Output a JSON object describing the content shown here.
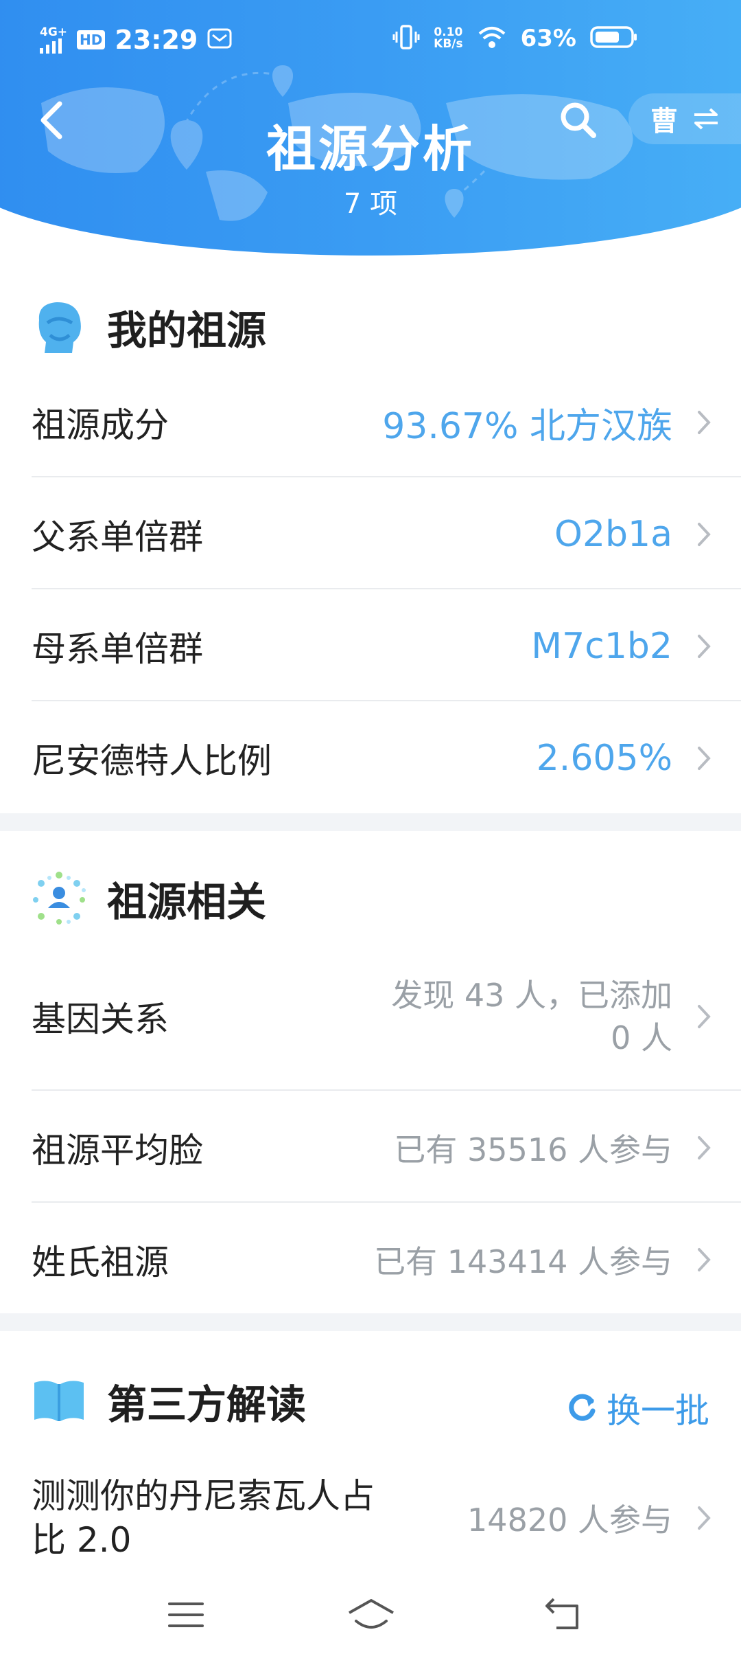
{
  "colors": {
    "header_gradient_start": "#2f8df0",
    "header_gradient_end": "#48b0f6",
    "accent_blue": "#4ea6ec",
    "muted_gray": "#9aa0a6",
    "divider": "#f2f4f7"
  },
  "status_bar": {
    "network": "4G+",
    "hd": "HD",
    "time": "23:29",
    "net_speed_value": "0.10",
    "net_speed_unit": "KB/s",
    "battery": "63%",
    "icons": [
      "signal-icon",
      "mail-icon",
      "vibrate-icon",
      "wifi-icon",
      "battery-icon"
    ]
  },
  "header": {
    "title": "祖源分析",
    "subtitle": "7 项",
    "surname": "曹",
    "icons": [
      "back-icon",
      "search-icon",
      "swap-icon"
    ]
  },
  "my_ancestry": {
    "title": "我的祖源",
    "rows": [
      {
        "label": "祖源成分",
        "value": "93.67% 北方汉族"
      },
      {
        "label": "父系单倍群",
        "value": "O2b1a"
      },
      {
        "label": "母系单倍群",
        "value": "M7c1b2"
      },
      {
        "label": "尼安德特人比例",
        "value": "2.605%"
      }
    ]
  },
  "related": {
    "title": "祖源相关",
    "rows": [
      {
        "label": "基因关系",
        "value_line1": "发现 43 人，已添加",
        "value_line2": "0 人"
      },
      {
        "label": "祖源平均脸",
        "value": "已有 35516 人参与"
      },
      {
        "label": "姓氏祖源",
        "value": "已有 143414 人参与"
      }
    ]
  },
  "third_party": {
    "title": "第三方解读",
    "refresh_label": "换一批",
    "rows": [
      {
        "label_line1": "测测你的丹尼索瓦人占",
        "label_line2": "比 2.0",
        "value": "14820 人参与"
      }
    ]
  },
  "nav_bar": {
    "icons": [
      "menu-icon",
      "home-icon",
      "back-nav-icon"
    ]
  }
}
